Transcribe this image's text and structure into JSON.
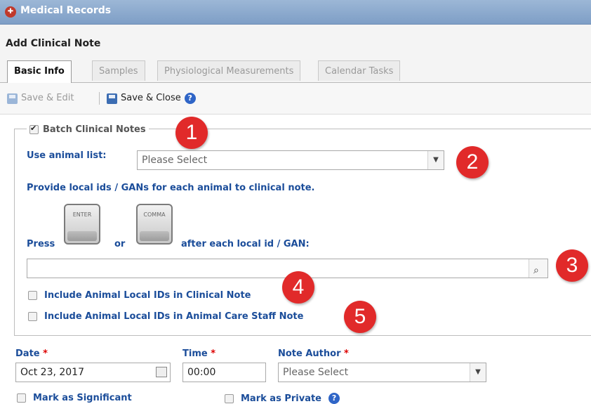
{
  "window": {
    "title": "Medical Records"
  },
  "header": {
    "title": "Add Clinical Note"
  },
  "tabs": [
    {
      "label": "Basic Info",
      "active": true
    },
    {
      "label": "Samples",
      "active": false
    },
    {
      "label": "Physiological Measurements",
      "active": false
    },
    {
      "label": "Calendar Tasks",
      "active": false
    }
  ],
  "toolbar": {
    "save_edit_label": "Save & Edit",
    "save_close_label": "Save & Close",
    "help_glyph": "?"
  },
  "batch": {
    "legend": "Batch Clinical Notes",
    "checked": true,
    "animal_list_label": "Use animal list:",
    "animal_list_value": "Please Select",
    "provide_text": "Provide local ids / GANs for each animal to clinical note.",
    "press_label": "Press",
    "or_label": "or",
    "after_label": "after each local id / GAN:",
    "enter_key": "ENTER",
    "comma_key": "COMMA",
    "ids_value": "",
    "include_clinical": "Include Animal Local IDs in Clinical Note",
    "include_staff": "Include Animal Local IDs in Animal Care Staff Note"
  },
  "fields": {
    "date_label": "Date",
    "date_value": "Oct 23, 2017",
    "time_label": "Time",
    "time_value": "00:00",
    "author_label": "Note Author",
    "author_value": "Please Select",
    "required_mark": "*",
    "significant_label": "Mark as Significant",
    "private_label": "Mark as Private"
  },
  "annotations": [
    "1",
    "2",
    "3",
    "4",
    "5"
  ],
  "colors": {
    "titlebar": "#8aa8cf",
    "label_blue": "#1b4d9a",
    "badge_red": "#e12a2a"
  }
}
